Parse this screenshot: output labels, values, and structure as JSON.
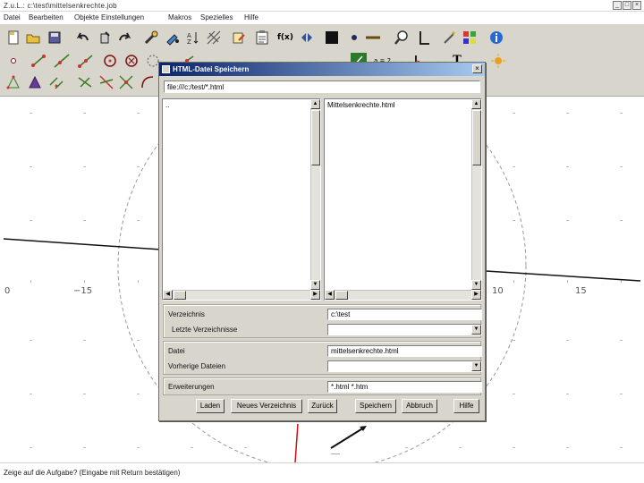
{
  "window": {
    "title": "Z.u.L.: c:\\test\\mittelsenkrechte.job"
  },
  "menu": [
    "Datei",
    "Bearbeiten",
    "Objekte",
    "Einstellungen",
    "Makros",
    "Spezielles",
    "Hilfe"
  ],
  "toolbar": {
    "row1_icons": [
      "new-file-icon",
      "open-folder-icon",
      "save-disk-icon",
      "undo-icon",
      "delete-icon",
      "redo-icon",
      "tools-icon",
      "paint-icon",
      "sort-icon",
      "hatch-icon",
      "edit-icon",
      "clipboard-icon",
      "function-icon",
      "swap-icon",
      "black-square-icon",
      "dot-icon",
      "line-icon",
      "zoom-icon",
      "axes-icon",
      "magic-wand-icon",
      "color-grid-icon",
      "info-icon"
    ],
    "function_label": "f(x)",
    "row2_icons": [
      "point-icon",
      "segment-icon",
      "line-tool-icon",
      "ray-icon",
      "circle-icon",
      "circle-point-icon",
      "compass-icon",
      "midpoint-icon"
    ],
    "row2_right_icons": [
      "angle-icon",
      "a-equals-b-icon",
      "angle-mark-icon",
      "text-icon",
      "sun-icon"
    ],
    "ab_label": "a = 2",
    "text_label": "T",
    "row3_icons": [
      "polygon-icon",
      "triangle-icon",
      "parallel-icon",
      "perpendicular-icon",
      "intersect-icon",
      "locus-icon",
      "arc-icon"
    ]
  },
  "canvas": {
    "x_labels": [
      "0",
      "−15",
      "10",
      "15"
    ]
  },
  "dialog": {
    "title": "HTML-Datei Speichern",
    "path": "file:///c:/test/*.html",
    "dir_entries": [
      ".."
    ],
    "file_entries": [
      "Mittelsenkrechte.html"
    ],
    "fields": {
      "directory_label": "Verzeichnis",
      "directory_value": "c:\\test",
      "last_dirs_label": "Letzte Verzeichnisse",
      "last_dirs_value": "",
      "file_label": "Datei",
      "file_value": "mittelsenkrechte.html",
      "prev_files_label": "Vorherige Dateien",
      "prev_files_value": "",
      "ext_label": "Erweiterungen",
      "ext_value": "*.html *.htm"
    },
    "buttons": [
      "Laden",
      "Neues Verzeichnis",
      "Zurück",
      "Speichern",
      "Abbruch",
      "Hilfe"
    ]
  },
  "status": {
    "text": "Zeige auf die Aufgabe? (Eingabe mit Return bestätigen)"
  }
}
